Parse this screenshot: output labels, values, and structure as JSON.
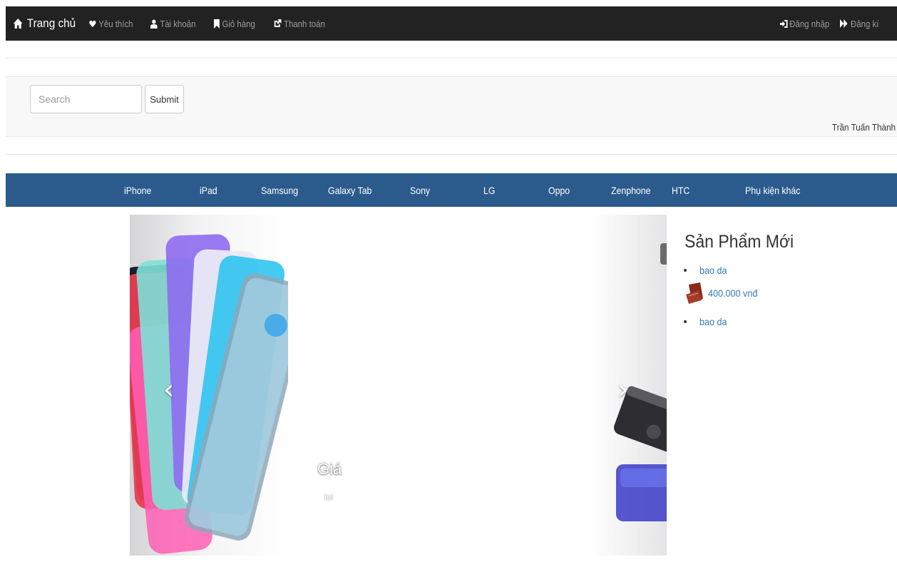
{
  "navbar": {
    "brand": "Trang chủ",
    "links": [
      "Yêu thích",
      "Tài khoản",
      "Giỏ hàng",
      "Thanh toán"
    ],
    "login": "Đăng nhập",
    "register": "Đăng kí",
    "icons": {
      "brand": "home-icon",
      "links": [
        "heart-icon",
        "user-icon",
        "bookmark-icon",
        "share-icon"
      ],
      "login": "log-in-icon",
      "register": "fast-forward-icon"
    },
    "background": "#222222",
    "text_color": "#9d9d9d"
  },
  "search": {
    "placeholder": "Search",
    "submit_label": "Submit"
  },
  "user": {
    "name": "Trần Tuấn Thành"
  },
  "categories": {
    "items": [
      "iPhone",
      "iPad",
      "Samsung",
      "Galaxy Tab",
      "Sony",
      "LG",
      "Oppo",
      "Zenphone",
      "HTC",
      "Phụ kiện khác"
    ],
    "background": "#2b5b8c"
  },
  "carousel": {
    "caption_title": "Giá",
    "caption_text": "loi",
    "prev_icon": "chevron-left-icon",
    "next_icon": "chevron-right-icon"
  },
  "sidebar": {
    "title": "Sản Phẩm Mới",
    "items": [
      {
        "name": "bao da"
      },
      {
        "price": "400.000 vnđ"
      },
      {
        "name": "bao da"
      }
    ],
    "link_color": "#337ab7"
  }
}
